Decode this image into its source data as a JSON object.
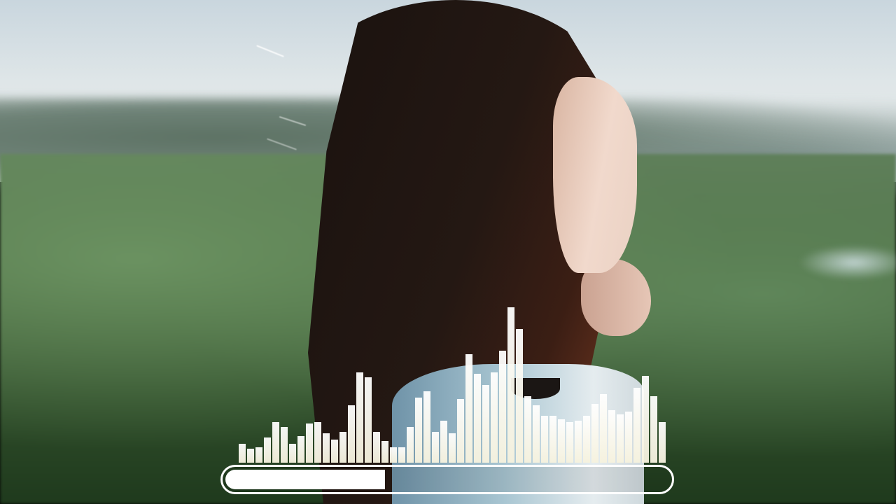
{
  "scene": {
    "background": "blurred-green-hillside",
    "subject": "woman-in-profile"
  },
  "visualizer": {
    "bar_color": "#f6f2de",
    "levels": [
      0.12,
      0.09,
      0.1,
      0.16,
      0.26,
      0.23,
      0.12,
      0.17,
      0.25,
      0.26,
      0.19,
      0.15,
      0.2,
      0.37,
      0.58,
      0.55,
      0.2,
      0.14,
      0.1,
      0.1,
      0.23,
      0.42,
      0.46,
      0.2,
      0.27,
      0.19,
      0.41,
      0.7,
      0.57,
      0.5,
      0.58,
      0.72,
      1.0,
      0.86,
      0.43,
      0.37,
      0.3,
      0.3,
      0.28,
      0.26,
      0.27,
      0.3,
      0.38,
      0.44,
      0.34,
      0.31,
      0.33,
      0.48,
      0.56,
      0.43,
      0.26
    ]
  },
  "player": {
    "progress": 0.36,
    "accent": "#ffffff"
  }
}
